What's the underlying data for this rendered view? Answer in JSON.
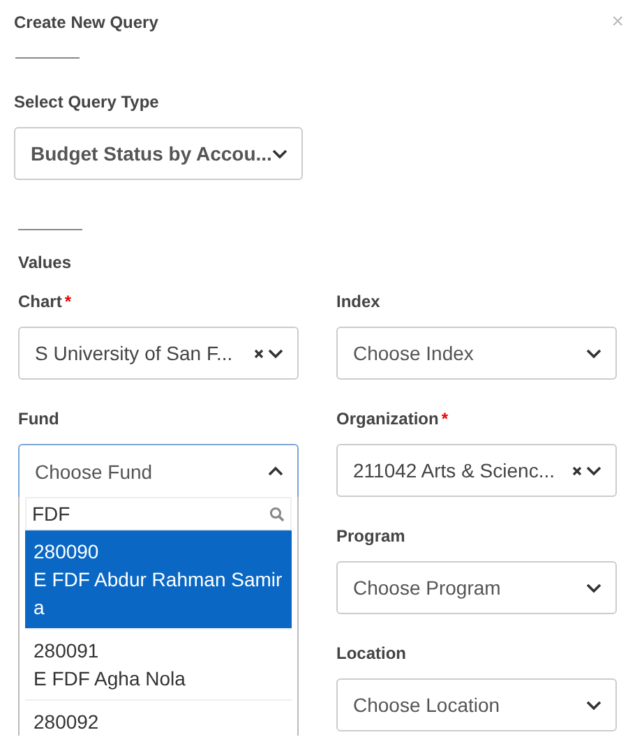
{
  "dialog": {
    "title": "Create New Query",
    "close": "×"
  },
  "query_type": {
    "label": "Select Query Type",
    "value": "Budget Status by Accou...",
    "open": false
  },
  "values": {
    "heading": "Values",
    "left_column": [
      {
        "label": "Chart",
        "required_mark": "*",
        "value": "S University of San F...",
        "clearable": true,
        "open": false
      },
      {
        "label": "Fund",
        "placeholder": "Choose Fund",
        "clearable": false,
        "open": true,
        "dropdown": {
          "search": "FDF",
          "options": [
            {
              "code": "280090",
              "name": "E FDF Abdur Rahman Samira",
              "selected": true
            },
            {
              "code": "280091",
              "name": "E FDF Agha Nola",
              "selected": false
            },
            {
              "code": "280092",
              "selected": false
            }
          ]
        }
      }
    ],
    "right_column": [
      {
        "label": "Index",
        "placeholder": "Choose Index",
        "clearable": false,
        "open": false
      },
      {
        "label": "Organization",
        "required_mark": "*",
        "value": "211042 Arts & Scienc...",
        "clearable": true,
        "open": false
      },
      {
        "label": "Program",
        "placeholder": "Choose Program",
        "clearable": false,
        "open": false
      },
      {
        "label": "Location",
        "placeholder": "Choose Location",
        "clearable": false,
        "open": false
      }
    ]
  }
}
